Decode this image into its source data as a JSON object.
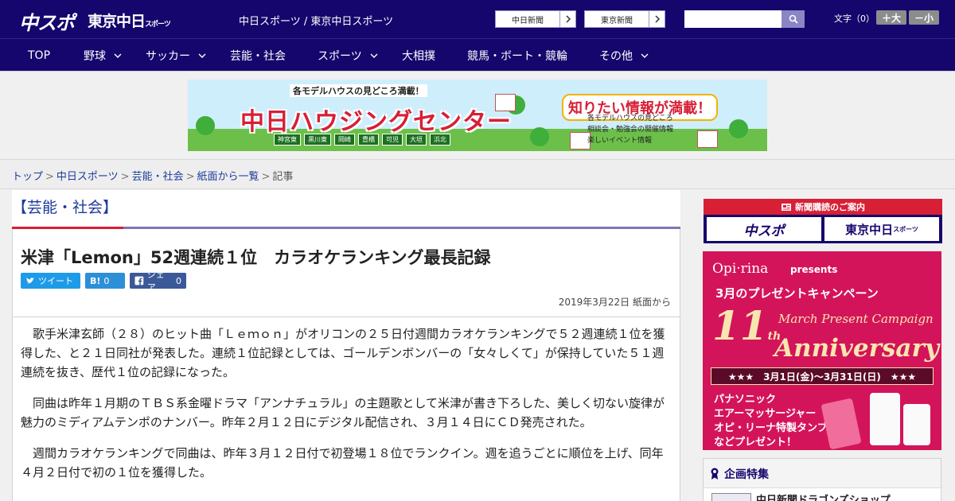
{
  "header": {
    "logo_main": "中スポ",
    "logo_sub": "東京中日",
    "logo_sub_small": "スポーツ",
    "tagline": "中日スポーツ / 東京中日スポーツ",
    "ext_links": [
      {
        "label": "中日新聞"
      },
      {
        "label": "東京新聞"
      }
    ],
    "search": {
      "placeholder": "",
      "icon": "search-icon"
    },
    "font_size": {
      "label": "文字（0）",
      "increase": "＋大",
      "decrease": "－小"
    }
  },
  "nav": {
    "items": [
      {
        "label": "TOP",
        "has_dropdown": false
      },
      {
        "label": "野球",
        "has_dropdown": true
      },
      {
        "label": "サッカー",
        "has_dropdown": true
      },
      {
        "label": "芸能・社会",
        "has_dropdown": false
      },
      {
        "label": "スポーツ",
        "has_dropdown": true
      },
      {
        "label": "大相撲",
        "has_dropdown": false
      },
      {
        "label": "競馬・ボート・競輪",
        "has_dropdown": false
      },
      {
        "label": "その他",
        "has_dropdown": true
      }
    ]
  },
  "banner": {
    "top_note": "各モデルハウスの見どころ満載！",
    "title": "中日ハウジングセンター",
    "callout": "知りたい情報が満載！",
    "bullets": [
      "各モデルハウスの見どころ",
      "相談会・勉強会の開催情報",
      "楽しいイベント情報"
    ],
    "cities": [
      "神宮東",
      "黒川東",
      "岡崎",
      "豊橋",
      "可児",
      "大垣",
      "浜北"
    ]
  },
  "breadcrumb": {
    "items": [
      "トップ",
      "中日スポーツ",
      "芸能・社会",
      "紙面から一覧"
    ],
    "current": "記事",
    "separator": ">"
  },
  "article": {
    "category": "【芸能・社会】",
    "headline": "米津「Lemon」52週連続１位　カラオケランキング最長記録",
    "share": {
      "tweet": "ツイート",
      "hatena_icon": "B!",
      "hatena_count": "0",
      "facebook": "シェア",
      "facebook_count": "0"
    },
    "dateline": "2019年3月22日 紙面から",
    "paragraphs": [
      "歌手米津玄師（２８）のヒット曲「Ｌｅｍｏｎ」がオリコンの２５日付週間カラオケランキングで５２週連続１位を獲得した、と２１日同社が発表した。連続１位記録としては、ゴールデンボンバーの「女々しくて」が保持していた５１週連続を抜き、歴代１位の記録になった。",
      "同曲は昨年１月期のＴＢＳ系金曜ドラマ「アンナチュラル」の主題歌として米津が書き下ろした、美しく切ない旋律が魅力のミディアムテンポのナンバー。昨年２月１２日にデジタル配信され、３月１４日にＣＤ発売された。",
      "週間カラオケランキングで同曲は、昨年３月１２日付で初登場１８位でランクイン。週を追うごとに順位を上げ、同年４月２日付で初の１位を獲得した。"
    ]
  },
  "sidebar": {
    "subscribe": {
      "header": "新聞購読のご案内",
      "options": [
        "中スポ",
        "東京中日"
      ],
      "option_small": "スポーツ"
    },
    "promo": {
      "brand": "Opi·rina",
      "presents": "presents",
      "campaign": "3月のプレゼントキャンペーン",
      "number": "11",
      "number_suffix": "th",
      "eng": "March Present Campaign",
      "anniversary": "Anniversary",
      "dates": "★★★　3月1日(金)〜3月31日(日)　★★★",
      "item_lines": [
        "パナソニック",
        "エアーマッサージャー",
        "オピ・リーナ特製タンブラー",
        "などプレゼント！"
      ]
    },
    "feature": {
      "header": "企画特集",
      "first_item": "中日新聞ドラゴンズショップ"
    }
  }
}
